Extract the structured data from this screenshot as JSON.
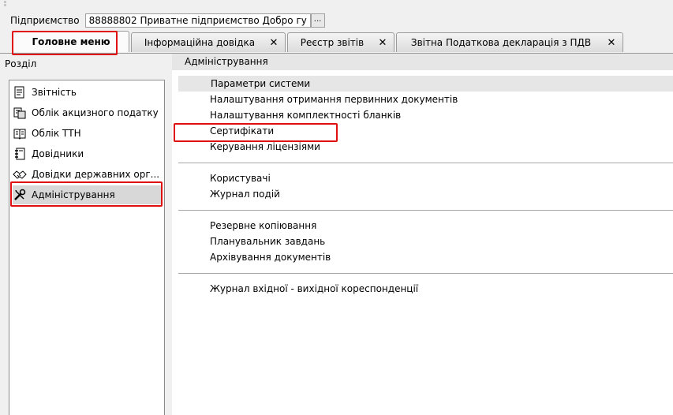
{
  "enterprise": {
    "label": "Підприємство",
    "value": "88888802  Приватне підприємство Добро гу",
    "button": "..."
  },
  "tabs": [
    {
      "label": "Головне меню",
      "closable": false
    },
    {
      "label": "Інформаційна довідка",
      "closable": true
    },
    {
      "label": "Реєстр звітів",
      "closable": true
    },
    {
      "label": "Звітна Податкова декларація з ПДВ",
      "closable": true
    }
  ],
  "close_glyph": "✕",
  "sidebar": {
    "title": "Розділ",
    "items": [
      {
        "label": "Звітність",
        "icon": "document-icon"
      },
      {
        "label": "Облік акцизного податку",
        "icon": "excise-icon"
      },
      {
        "label": "Облік ТТН",
        "icon": "book-icon"
      },
      {
        "label": "Довідники",
        "icon": "notebook-icon"
      },
      {
        "label": "Довідки державних орг...",
        "icon": "handshake-icon"
      },
      {
        "label": "Адміністрування",
        "icon": "tools-icon",
        "selected": true
      }
    ]
  },
  "main": {
    "header": "Адміністрування",
    "groups": [
      [
        "Параметри системи",
        "Налаштування отримання первинних документів",
        "Налаштування комплектності бланків",
        "Сертифікати",
        "Керування ліцензіями"
      ],
      [
        "Користувачі",
        "Журнал подій"
      ],
      [
        "Резервне копіювання",
        "Планувальник завдань",
        "Архівування документів"
      ],
      [
        "Журнал вхідної - вихідної кореспонденції"
      ]
    ]
  },
  "colors": {
    "highlight": "#e01010",
    "selected_bg": "#d8d8d8"
  }
}
